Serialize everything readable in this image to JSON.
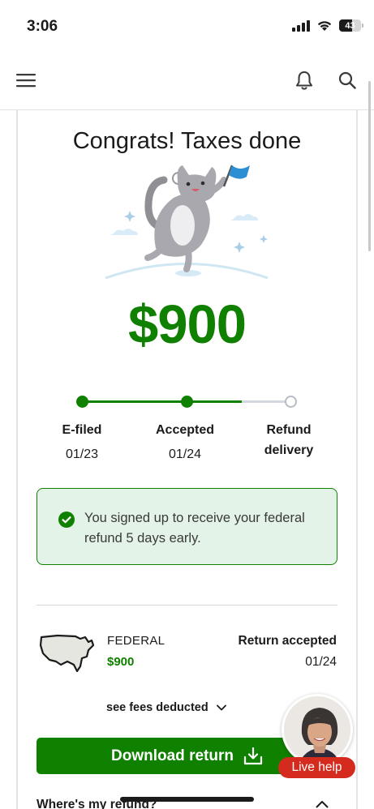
{
  "status_bar": {
    "time": "3:06",
    "battery": "43"
  },
  "header": {
    "menu_icon": "hamburger-menu-icon",
    "bell_icon": "bell-icon",
    "search_icon": "search-icon"
  },
  "main": {
    "title": "Congrats! Taxes done",
    "amount": "$900",
    "progress": {
      "steps": [
        {
          "label": "E-filed",
          "date": "01/23",
          "status": "complete"
        },
        {
          "label": "Accepted",
          "date": "01/24",
          "status": "complete"
        },
        {
          "label": "Refund delivery",
          "date": "",
          "status": "pending"
        }
      ]
    },
    "notice": {
      "text": "You signed up to receive your federal refund 5 days early."
    },
    "federal": {
      "label": "FEDERAL",
      "amount": "$900",
      "status": "Return accepted",
      "date": "01/24"
    },
    "fees_link": "see fees deducted",
    "download_button": "Download return",
    "refund_question": "Where's my refund?"
  },
  "live_help": {
    "label": "Live help"
  },
  "colors": {
    "accent_green": "#108000",
    "notice_bg": "#e4f3e7",
    "live_help_red": "#d52b1e"
  }
}
